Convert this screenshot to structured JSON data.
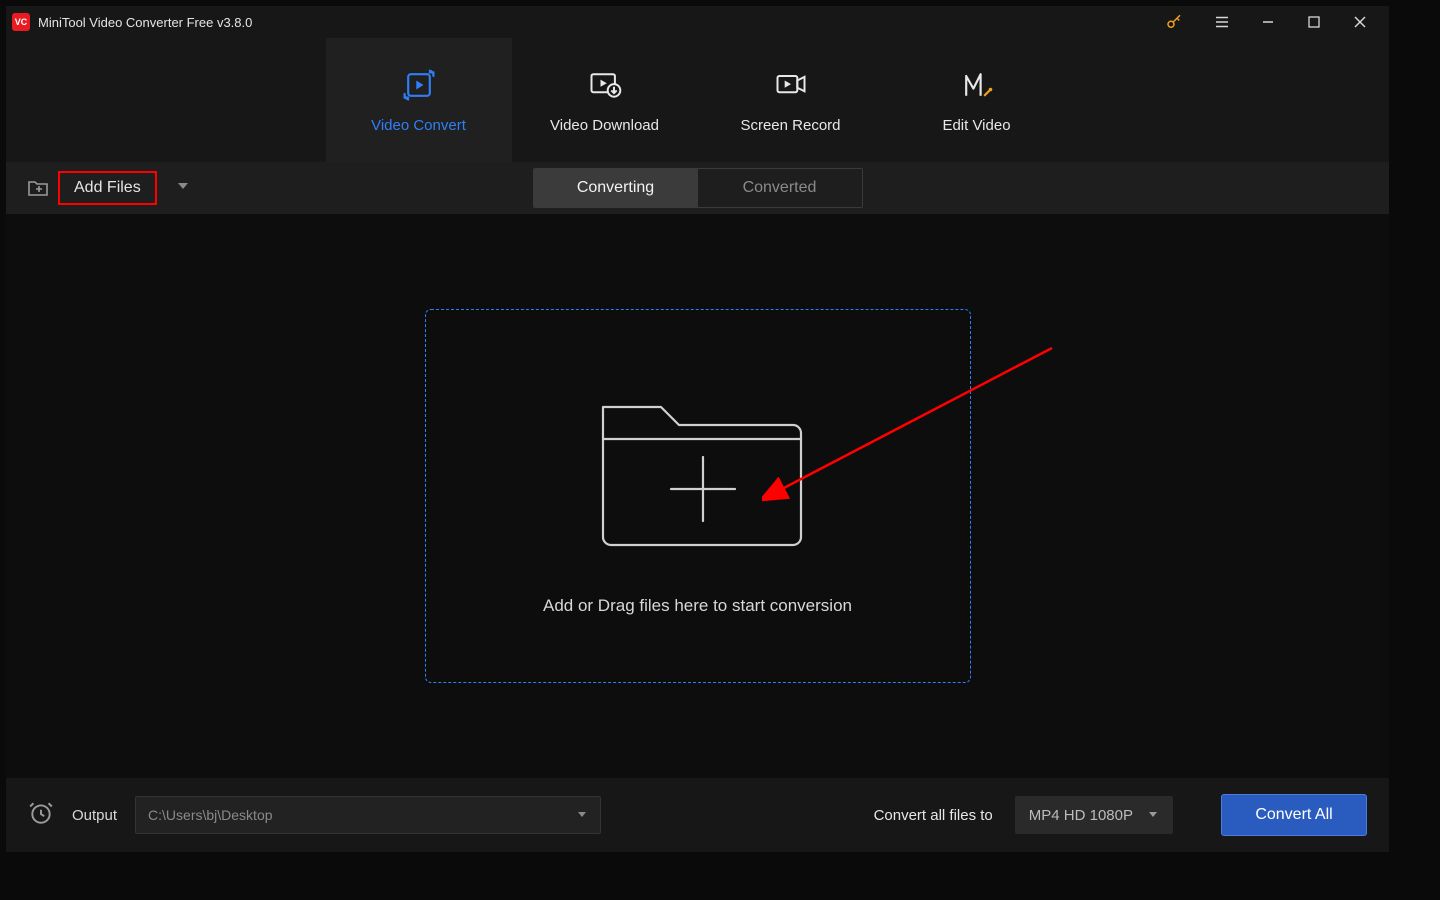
{
  "titlebar": {
    "app_title": "MiniTool Video Converter Free v3.8.0"
  },
  "nav": {
    "tabs": [
      {
        "label": "Video Convert",
        "active": true
      },
      {
        "label": "Video Download",
        "active": false
      },
      {
        "label": "Screen Record",
        "active": false
      },
      {
        "label": "Edit Video",
        "active": false
      }
    ]
  },
  "toolbar": {
    "add_files_label": "Add Files",
    "segmented": {
      "converting": "Converting",
      "converted": "Converted",
      "active": "converting"
    }
  },
  "dropzone": {
    "message": "Add or Drag files here to start conversion"
  },
  "footer": {
    "output_label": "Output",
    "output_path": "C:\\Users\\bj\\Desktop",
    "convert_all_to_label": "Convert all files to",
    "format_selected": "MP4 HD 1080P",
    "convert_all_button": "Convert All"
  },
  "icons": {
    "app_logo": "VC",
    "key": "key-icon",
    "hamburger": "hamburger-icon",
    "minimize": "minimize-icon",
    "maximize": "maximize-icon",
    "close": "close-icon",
    "video_convert": "refresh-play-icon",
    "video_download": "download-play-icon",
    "screen_record": "screen-record-icon",
    "edit_video": "edit-video-icon",
    "add_folder": "folder-plus-icon",
    "dropdown": "chevron-down-icon",
    "folder_plus_big": "folder-plus-large-icon",
    "clock": "clock-icon"
  },
  "colors": {
    "accent_blue": "#2f7ff6",
    "highlight_red": "#ff0000",
    "bg_dark": "#0d0d0d",
    "bg_panel": "#171717"
  }
}
